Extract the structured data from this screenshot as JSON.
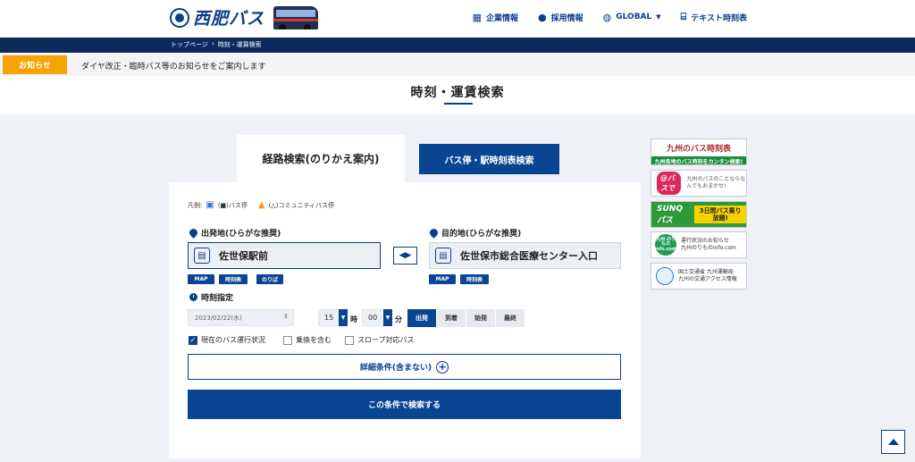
{
  "header": {
    "logo_text": "西肥バス",
    "nav": [
      {
        "label": "企業情報",
        "icon": "building-icon"
      },
      {
        "label": "採用情報",
        "icon": "person-icon"
      },
      {
        "label": "GLOBAL",
        "icon": "globe-icon"
      },
      {
        "label": "テキスト時刻表",
        "icon": "timetable-icon"
      }
    ]
  },
  "breadcrumb": {
    "home": "トップページ",
    "sep": "›",
    "current": "時刻・運賃検索"
  },
  "notice": {
    "badge": "お知らせ",
    "text": "ダイヤ改正・臨時バス等のお知らせをご案内します"
  },
  "page_title": "時刻・運賃検索",
  "tabs": {
    "route": "経路検索(のりかえ案内)",
    "stop": "バス停・駅時刻表検索"
  },
  "legend": {
    "prefix": "凡例:",
    "bus": "(■)バス停",
    "community": "(△)コミュニティバス停"
  },
  "origin": {
    "label": "出発地(ひらがな推奨)",
    "value": "佐世保駅前",
    "buttons": [
      "MAP",
      "時刻表",
      "のりば"
    ]
  },
  "destination": {
    "label": "目的地(ひらがな推奨)",
    "value": "佐世保市総合医療センター入口",
    "buttons": [
      "MAP",
      "時刻表"
    ]
  },
  "time": {
    "label": "時刻指定",
    "date": "2023/02/22(水)",
    "hour": "15",
    "hour_unit": "時",
    "minute": "00",
    "minute_unit": "分",
    "modes": [
      "出発",
      "到着",
      "始発",
      "最終"
    ],
    "selected_mode": "出発"
  },
  "options": [
    {
      "label": "現在のバス運行状況",
      "checked": true
    },
    {
      "label": "乗換を含む",
      "checked": false
    },
    {
      "label": "スロープ対応バス",
      "checked": false
    }
  ],
  "detail_button": "詳細条件(含まない)",
  "search_button": "この条件で検索する",
  "banners": {
    "b1_top": "九州のバス時刻表",
    "b1_bottom": "九州各地のバス時刻をカンタン検索!",
    "b2_mark": "@バスで",
    "b2_text": "九州のバスのことならなんでもおまかせ!",
    "b3_mark": "SUNQパス",
    "b3_text": "3日間バス乗り放題!",
    "b4_mark": "九州 のりもの info.com",
    "b4_text_1": "運行状況のお知らせ",
    "b4_text_2": "九州のりものinfo.com",
    "b5_text_1": "国土交通省 九州運輸局",
    "b5_text_2": "九州の交通アクセス情報"
  },
  "colors": {
    "primary": "#0a4592",
    "notice": "#f5a300",
    "dark_bar": "#0d2a5c"
  }
}
